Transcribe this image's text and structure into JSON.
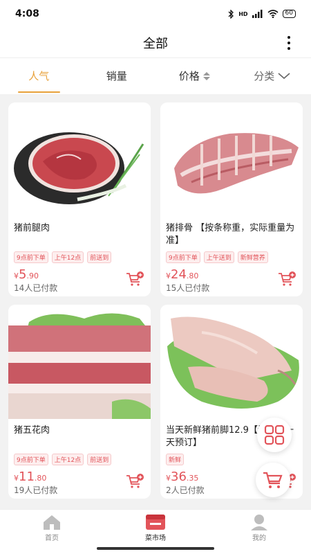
{
  "status": {
    "time": "4:08",
    "signal": "HD",
    "battery": "60"
  },
  "header": {
    "title": "全部"
  },
  "tabs": [
    {
      "label": "人气"
    },
    {
      "label": "销量"
    },
    {
      "label": "价格"
    },
    {
      "label": "分类"
    }
  ],
  "products": [
    {
      "name": "猪前腿肉",
      "tags": [
        "9点前下单",
        "上午12点",
        "前送到"
      ],
      "currency": "¥",
      "price_int": "5",
      "price_dec": ".90",
      "sold": "14人已付款"
    },
    {
      "name": "猪排骨 【按条称重，实际重量为准】",
      "tags": [
        "9点前下单",
        "上午送到",
        "新鲜营养"
      ],
      "currency": "¥",
      "price_int": "24",
      "price_dec": ".80",
      "sold": "15人已付款"
    },
    {
      "name": "猪五花肉",
      "tags": [
        "9点前下单",
        "上午12点",
        "前送到"
      ],
      "currency": "¥",
      "price_int": "11",
      "price_dec": ".80",
      "sold": "19人已付款"
    },
    {
      "name": "当天新鲜猪前脚12.9【请提前一天预订】",
      "tags": [
        "新鲜"
      ],
      "currency": "¥",
      "price_int": "36",
      "price_dec": ".35",
      "sold": "2人已付款"
    }
  ],
  "bottom_nav": [
    {
      "label": "首页",
      "icon": "home-icon"
    },
    {
      "label": "菜市场",
      "icon": "market-icon"
    },
    {
      "label": "我的",
      "icon": "user-icon"
    }
  ],
  "colors": {
    "accent": "#e8a13a",
    "price": "#e2545a"
  }
}
